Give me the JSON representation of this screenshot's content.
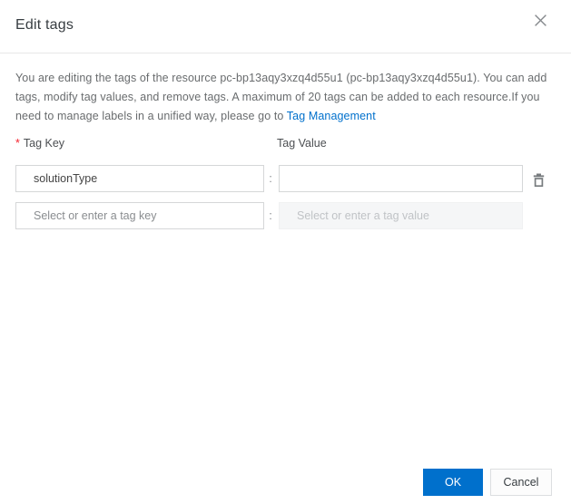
{
  "dialog": {
    "title": "Edit tags"
  },
  "description": {
    "text_before_link": "You are editing the tags of the resource pc-bp13aqy3xzq4d55u1 (pc-bp13aqy3xzq4d55u1). You can add tags, modify tag values, and remove tags. A maximum of 20 tags can be added to each resource.If you need to manage labels in a unified way, please go to ",
    "link_label": "Tag Management"
  },
  "form": {
    "required_marker": "*",
    "key_label": "Tag Key",
    "value_label": "Tag Value",
    "separator": ":",
    "rows": [
      {
        "key_value": "solutionType",
        "key_placeholder": "",
        "value_value": "",
        "value_placeholder": "",
        "value_disabled": false
      },
      {
        "key_value": "",
        "key_placeholder": "Select or enter a tag key",
        "value_value": "",
        "value_placeholder": "Select or enter a tag value",
        "value_disabled": true
      }
    ],
    "icons": {
      "delete": "trash-icon",
      "close": "close-icon"
    }
  },
  "footer": {
    "ok_label": "OK",
    "cancel_label": "Cancel"
  },
  "colors": {
    "primary": "#0070cc",
    "link": "#0070cc",
    "required": "#f5222d",
    "border": "#d5d7d8",
    "disabled_bg": "#f5f6f7"
  }
}
